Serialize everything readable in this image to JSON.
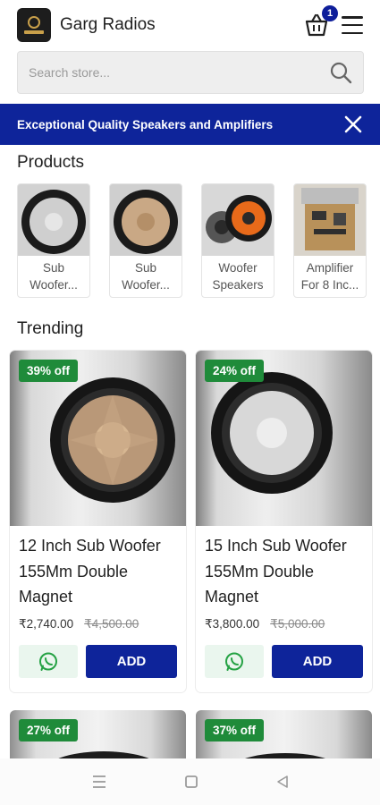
{
  "header": {
    "store_name": "Garg Radios",
    "cart_count": "1",
    "logo_icon": "store-logo",
    "cart_icon": "shopping-basket-icon",
    "menu_icon": "hamburger-menu-icon"
  },
  "search": {
    "placeholder": "Search store...",
    "value": "",
    "icon": "search-icon"
  },
  "banner": {
    "text": "Exceptional Quality Speakers and Amplifiers",
    "close_icon": "close-icon",
    "color": "#0e249a"
  },
  "products_section": {
    "title": "Products",
    "items": [
      {
        "label": "Sub Woofer..."
      },
      {
        "label": "Sub Woofer..."
      },
      {
        "label": "Woofer Speakers"
      },
      {
        "label": "Amplifier For 8 Inc..."
      }
    ]
  },
  "trending_section": {
    "title": "Trending",
    "cards": [
      {
        "discount": "39% off",
        "title": "12 Inch Sub Woofer 155Mm Double Magnet",
        "price": "₹2,740.00",
        "mrp": "₹4,500.00",
        "add_label": "ADD"
      },
      {
        "discount": "24% off",
        "title": "15 Inch Sub Woofer 155Mm Double Magnet",
        "price": "₹3,800.00",
        "mrp": "₹5,000.00",
        "add_label": "ADD"
      },
      {
        "discount": "27% off"
      },
      {
        "discount": "37% off"
      }
    ]
  },
  "colors": {
    "primary": "#0e249a",
    "discount_badge": "#1f8b3a",
    "whatsapp": "#25a244"
  },
  "system_nav": {
    "icons": [
      "recent-apps-icon",
      "home-icon",
      "back-icon"
    ]
  }
}
